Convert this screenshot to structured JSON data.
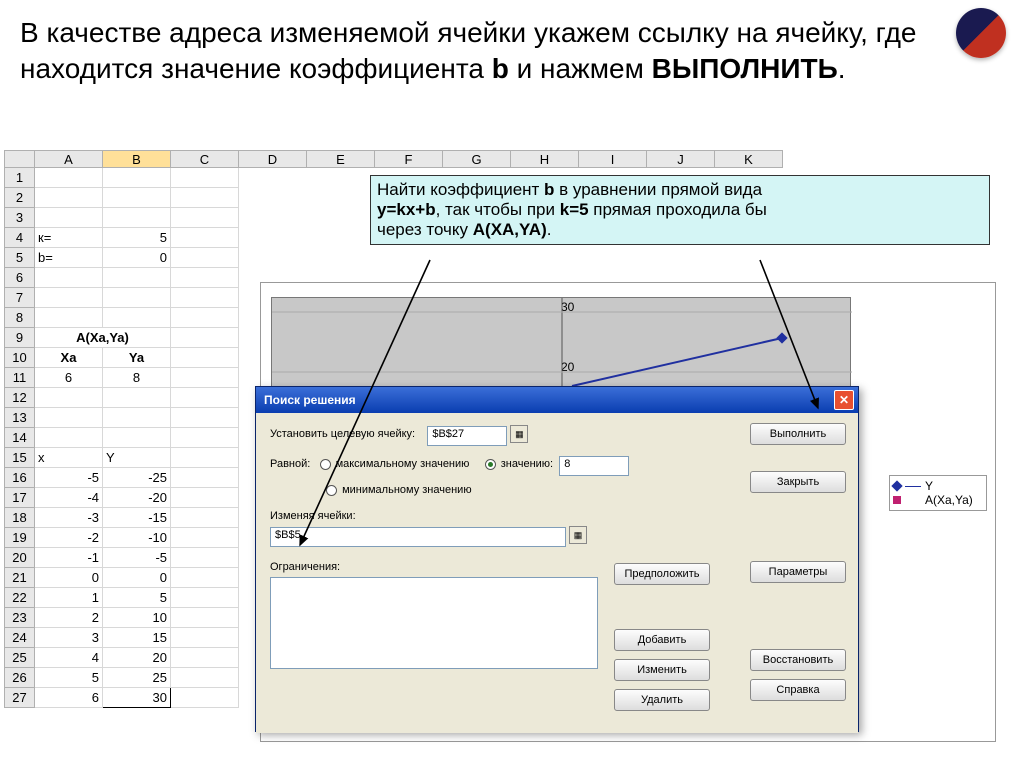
{
  "instruction_pre": "В качестве адреса изменяемой ячейки укажем ссылку на ячейку, где находится значение коэффициента ",
  "instruction_bold_b": "b",
  "instruction_mid": " и нажмем ",
  "instruction_bold_exec": "ВЫПОЛНИТЬ",
  "instruction_post": ".",
  "columns": [
    "A",
    "B",
    "C",
    "D",
    "E",
    "F",
    "G",
    "H",
    "I",
    "J",
    "K"
  ],
  "rows": {
    "4": {
      "A": "к=",
      "B": "5"
    },
    "5": {
      "A": "b=",
      "B": "0"
    },
    "9": {
      "A": "A(Xa,Ya)"
    },
    "10": {
      "A": "Xa",
      "B": "Ya"
    },
    "11": {
      "A": "6",
      "B": "8"
    },
    "15": {
      "A": "x",
      "B": "Y"
    },
    "16": {
      "A": "-5",
      "B": "-25"
    },
    "17": {
      "A": "-4",
      "B": "-20"
    },
    "18": {
      "A": "-3",
      "B": "-15"
    },
    "19": {
      "A": "-2",
      "B": "-10"
    },
    "20": {
      "A": "-1",
      "B": "-5"
    },
    "21": {
      "A": "0",
      "B": "0"
    },
    "22": {
      "A": "1",
      "B": "5"
    },
    "23": {
      "A": "2",
      "B": "10"
    },
    "24": {
      "A": "3",
      "B": "15"
    },
    "25": {
      "A": "4",
      "B": "20"
    },
    "26": {
      "A": "5",
      "B": "25"
    },
    "27": {
      "A": "6",
      "B": "30"
    }
  },
  "callout": {
    "l1a": "Найти коэффициент ",
    "l1b": "b",
    "l1c": " в уравнении прямой вида",
    "l2a": "y=kx+b",
    "l2b": ", так чтобы при ",
    "l2c": "k=5",
    "l2d": " прямая проходила бы",
    "l3a": "через точку ",
    "l3b": "A(XA,YA)",
    "l3c": "."
  },
  "axis_top": "30",
  "axis_mid": "20",
  "legend": {
    "s1": "Y",
    "s2": "A(Xa,Ya)"
  },
  "dialog": {
    "title": "Поиск решения",
    "set_target": "Установить целевую ячейку:",
    "target_val": "$B$27",
    "equal": "Равной:",
    "opt_max": "максимальному значению",
    "opt_val": "значению:",
    "opt_min": "минимальному значению",
    "val_input": "8",
    "changing": "Изменяя ячейки:",
    "changing_val": "$B$5",
    "assume": "Предположить",
    "constraints": "Ограничения:",
    "btn_add": "Добавить",
    "btn_edit": "Изменить",
    "btn_del": "Удалить",
    "btn_exec": "Выполнить",
    "btn_close": "Закрыть",
    "btn_params": "Параметры",
    "btn_restore": "Восстановить",
    "btn_help": "Справка"
  }
}
